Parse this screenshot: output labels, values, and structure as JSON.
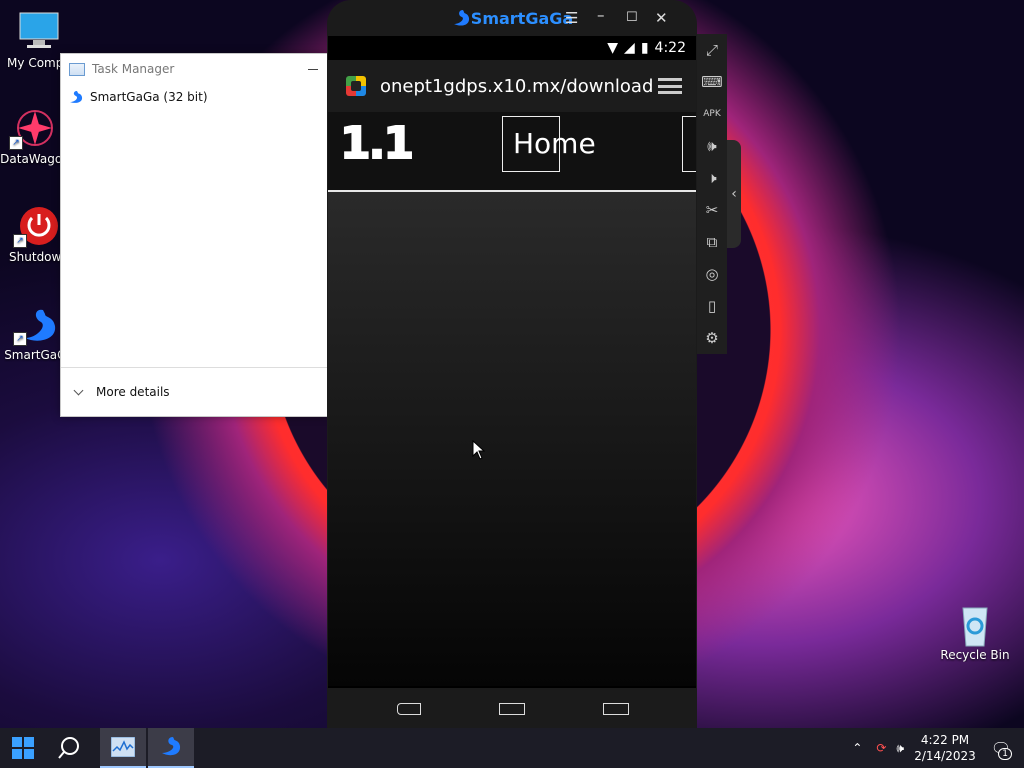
{
  "desktop": {
    "icons": [
      {
        "label": "My Compu"
      },
      {
        "label": "DataWagon"
      },
      {
        "label": "Shutdown"
      },
      {
        "label": "SmartGaGa"
      },
      {
        "label": "Recycle Bin"
      }
    ]
  },
  "task_manager": {
    "title": "Task Manager",
    "process": "SmartGaGa (32 bit)",
    "more_details": "More details"
  },
  "emulator": {
    "brand": "SmartGaGa",
    "status_time": "4:22",
    "url": "onept1gdps.x10.mx/download",
    "site_logo": "1.1",
    "home_label": "Home",
    "side_toolbar": [
      "fullscreen-icon",
      "keyboard-icon",
      "apk-icon",
      "volume-up-icon",
      "volume-down-icon",
      "scissors-icon",
      "multi-instance-icon",
      "location-icon",
      "shake-icon",
      "settings-icon"
    ]
  },
  "taskbar": {
    "time": "4:22 PM",
    "date": "2/14/2023",
    "notification_count": "1"
  }
}
